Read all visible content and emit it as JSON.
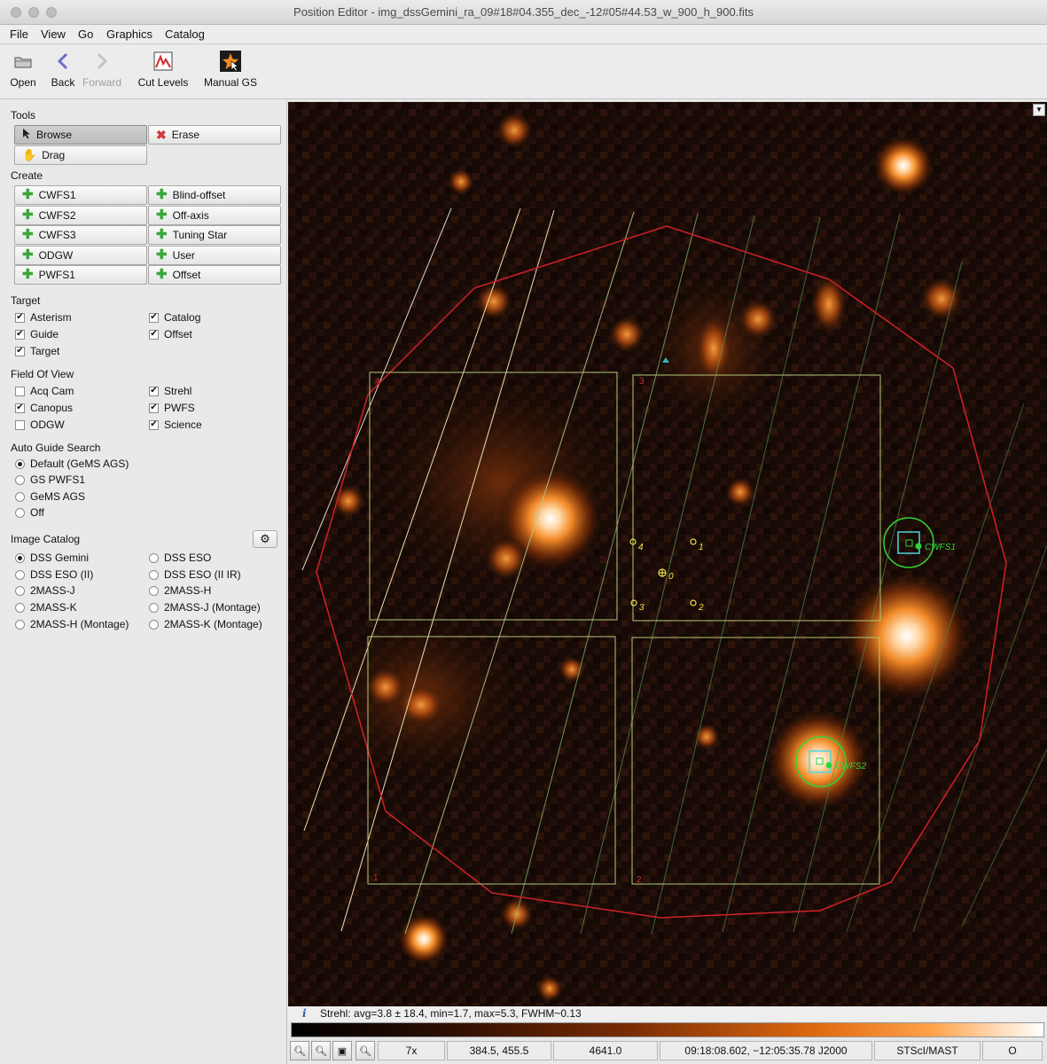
{
  "window": {
    "title": "Position Editor - img_dssGemini_ra_09#18#04.355_dec_-12#05#44.53_w_900_h_900.fits"
  },
  "menu": [
    "File",
    "View",
    "Go",
    "Graphics",
    "Catalog"
  ],
  "toolbar": {
    "open": "Open",
    "back": "Back",
    "forward": "Forward",
    "cut_levels": "Cut Levels",
    "manual_gs": "Manual GS"
  },
  "tools": {
    "title": "Tools",
    "browse": "Browse",
    "erase": "Erase",
    "drag": "Drag"
  },
  "create": {
    "title": "Create",
    "items": [
      "CWFS1",
      "Blind-offset",
      "CWFS2",
      "Off-axis",
      "CWFS3",
      "Tuning Star",
      "ODGW",
      "User",
      "PWFS1",
      "Offset"
    ]
  },
  "target": {
    "title": "Target",
    "items": [
      {
        "label": "Asterism",
        "checked": true
      },
      {
        "label": "Catalog",
        "checked": true
      },
      {
        "label": "Guide",
        "checked": true
      },
      {
        "label": "Offset",
        "checked": true
      },
      {
        "label": "Target",
        "checked": true
      }
    ]
  },
  "fov": {
    "title": "Field Of View",
    "items": [
      {
        "label": "Acq Cam",
        "checked": false
      },
      {
        "label": "Strehl",
        "checked": true
      },
      {
        "label": "Canopus",
        "checked": true
      },
      {
        "label": "PWFS",
        "checked": true
      },
      {
        "label": "ODGW",
        "checked": false
      },
      {
        "label": "Science",
        "checked": true
      }
    ]
  },
  "ags": {
    "title": "Auto Guide Search",
    "items": [
      {
        "label": "Default (GeMS AGS)",
        "selected": true
      },
      {
        "label": "GS PWFS1",
        "selected": false
      },
      {
        "label": "GeMS AGS",
        "selected": false
      },
      {
        "label": "Off",
        "selected": false
      }
    ]
  },
  "catalog": {
    "title": "Image Catalog",
    "items": [
      {
        "label": "DSS Gemini",
        "selected": true
      },
      {
        "label": "DSS ESO",
        "selected": false
      },
      {
        "label": "DSS ESO (II)",
        "selected": false
      },
      {
        "label": "DSS ESO (II IR)",
        "selected": false
      },
      {
        "label": "2MASS-J",
        "selected": false
      },
      {
        "label": "2MASS-H",
        "selected": false
      },
      {
        "label": "2MASS-K",
        "selected": false
      },
      {
        "label": "2MASS-J (Montage)",
        "selected": false
      },
      {
        "label": "2MASS-H (Montage)",
        "selected": false
      },
      {
        "label": "2MASS-K (Montage)",
        "selected": false
      }
    ]
  },
  "overlay": {
    "quadrants": [
      "4",
      "3",
      "1",
      "2"
    ],
    "asterism": [
      "0",
      "1",
      "2",
      "3",
      "4"
    ],
    "wfs": [
      "CWFS1",
      "CWFS2"
    ]
  },
  "status": {
    "info_icon": "i",
    "strehl": "Strehl: avg=3.8 ± 18.4,  min=1.7,  max=5.3,  FWHM~0.13",
    "zoom": "7x",
    "pixel": "384.5, 455.5",
    "value": "4641.0",
    "coords": "09:18:08.602, −12:05:35.78 J2000",
    "source": "STScI/MAST",
    "mode": "O"
  },
  "colors": {
    "fov_circle": "#d0202a",
    "quad": "#b5c77a",
    "wfs": "#2fd43a",
    "wfs_box": "#4fd6e0",
    "asterism": "#f2e24a"
  }
}
